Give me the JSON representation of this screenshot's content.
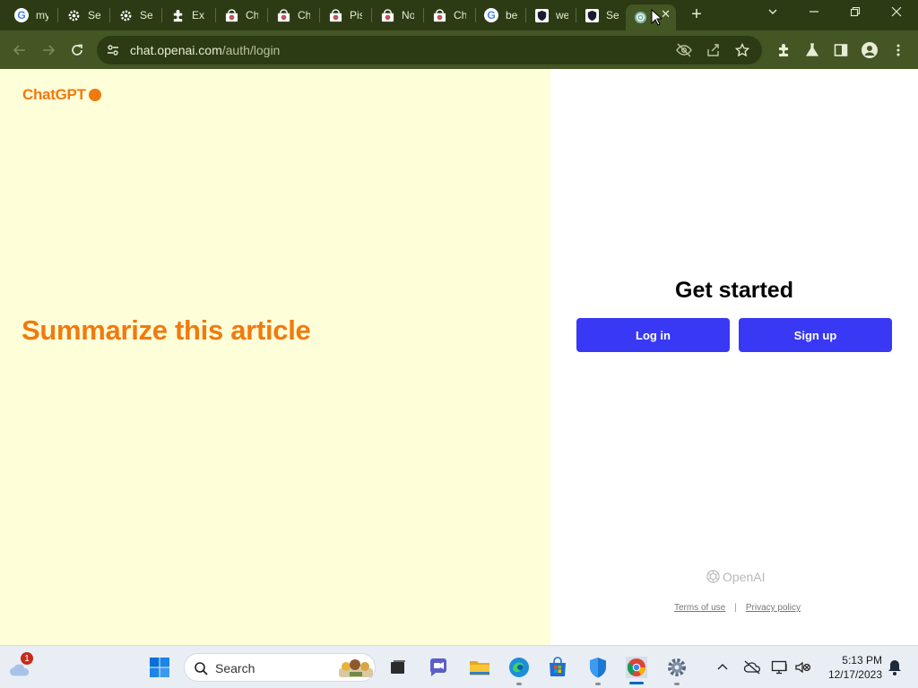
{
  "browser": {
    "tabs": [
      {
        "title": "my",
        "icon": "google-icon"
      },
      {
        "title": "Set",
        "icon": "gear-icon"
      },
      {
        "title": "Set",
        "icon": "gear-icon"
      },
      {
        "title": "Ext",
        "icon": "puzzle-icon"
      },
      {
        "title": "Chr",
        "icon": "chrome-store-icon"
      },
      {
        "title": "Chr",
        "icon": "chrome-store-icon"
      },
      {
        "title": "Pis",
        "icon": "chrome-store-icon"
      },
      {
        "title": "No",
        "icon": "chrome-store-icon"
      },
      {
        "title": "Ch",
        "icon": "chrome-store-icon"
      },
      {
        "title": "bes",
        "icon": "google-icon"
      },
      {
        "title": "wel",
        "icon": "shield-icon"
      },
      {
        "title": "Sea",
        "icon": "shield-icon"
      },
      {
        "title": "",
        "icon": "openai-icon"
      }
    ],
    "url_host": "chat.openai.com",
    "url_path": "/auth/login",
    "colors": {
      "frame": "#2c3b14",
      "toolbar": "#435624"
    }
  },
  "page": {
    "brand": "ChatGPT",
    "headline": "Summarize this article",
    "get_started": "Get started",
    "login_label": "Log in",
    "signup_label": "Sign up",
    "openai_label": "OpenAI",
    "terms_label": "Terms of use",
    "footer_sep": "|",
    "privacy_label": "Privacy policy",
    "colors": {
      "accent": "#f07a0f",
      "left_bg": "#fefed8",
      "button": "#3838f5"
    }
  },
  "taskbar": {
    "weather_badge": "1",
    "search_placeholder": "Search",
    "time": "5:13 PM",
    "date": "12/17/2023"
  }
}
